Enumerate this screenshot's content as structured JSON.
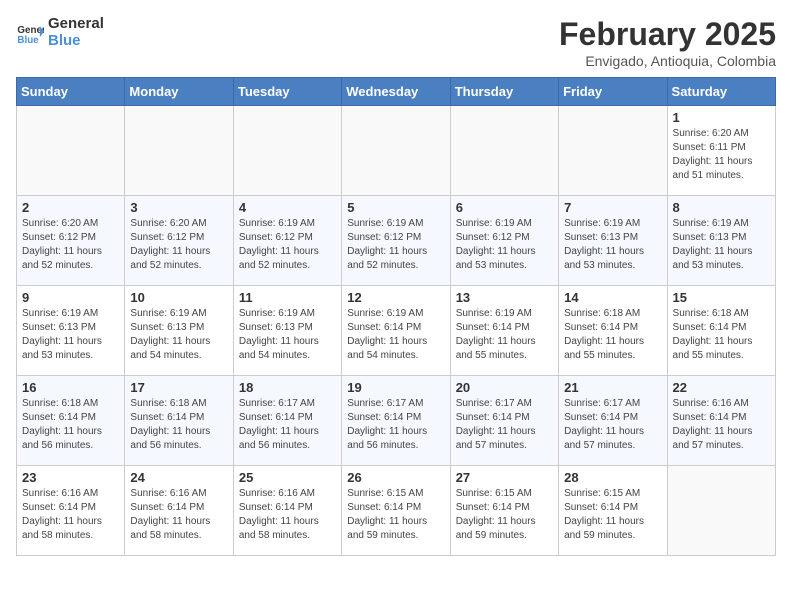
{
  "header": {
    "logo_line1": "General",
    "logo_line2": "Blue",
    "month_title": "February 2025",
    "location": "Envigado, Antioquia, Colombia"
  },
  "weekdays": [
    "Sunday",
    "Monday",
    "Tuesday",
    "Wednesday",
    "Thursday",
    "Friday",
    "Saturday"
  ],
  "weeks": [
    [
      {
        "day": "",
        "info": ""
      },
      {
        "day": "",
        "info": ""
      },
      {
        "day": "",
        "info": ""
      },
      {
        "day": "",
        "info": ""
      },
      {
        "day": "",
        "info": ""
      },
      {
        "day": "",
        "info": ""
      },
      {
        "day": "1",
        "info": "Sunrise: 6:20 AM\nSunset: 6:11 PM\nDaylight: 11 hours and 51 minutes."
      }
    ],
    [
      {
        "day": "2",
        "info": "Sunrise: 6:20 AM\nSunset: 6:12 PM\nDaylight: 11 hours and 52 minutes."
      },
      {
        "day": "3",
        "info": "Sunrise: 6:20 AM\nSunset: 6:12 PM\nDaylight: 11 hours and 52 minutes."
      },
      {
        "day": "4",
        "info": "Sunrise: 6:19 AM\nSunset: 6:12 PM\nDaylight: 11 hours and 52 minutes."
      },
      {
        "day": "5",
        "info": "Sunrise: 6:19 AM\nSunset: 6:12 PM\nDaylight: 11 hours and 52 minutes."
      },
      {
        "day": "6",
        "info": "Sunrise: 6:19 AM\nSunset: 6:12 PM\nDaylight: 11 hours and 53 minutes."
      },
      {
        "day": "7",
        "info": "Sunrise: 6:19 AM\nSunset: 6:13 PM\nDaylight: 11 hours and 53 minutes."
      },
      {
        "day": "8",
        "info": "Sunrise: 6:19 AM\nSunset: 6:13 PM\nDaylight: 11 hours and 53 minutes."
      }
    ],
    [
      {
        "day": "9",
        "info": "Sunrise: 6:19 AM\nSunset: 6:13 PM\nDaylight: 11 hours and 53 minutes."
      },
      {
        "day": "10",
        "info": "Sunrise: 6:19 AM\nSunset: 6:13 PM\nDaylight: 11 hours and 54 minutes."
      },
      {
        "day": "11",
        "info": "Sunrise: 6:19 AM\nSunset: 6:13 PM\nDaylight: 11 hours and 54 minutes."
      },
      {
        "day": "12",
        "info": "Sunrise: 6:19 AM\nSunset: 6:14 PM\nDaylight: 11 hours and 54 minutes."
      },
      {
        "day": "13",
        "info": "Sunrise: 6:19 AM\nSunset: 6:14 PM\nDaylight: 11 hours and 55 minutes."
      },
      {
        "day": "14",
        "info": "Sunrise: 6:18 AM\nSunset: 6:14 PM\nDaylight: 11 hours and 55 minutes."
      },
      {
        "day": "15",
        "info": "Sunrise: 6:18 AM\nSunset: 6:14 PM\nDaylight: 11 hours and 55 minutes."
      }
    ],
    [
      {
        "day": "16",
        "info": "Sunrise: 6:18 AM\nSunset: 6:14 PM\nDaylight: 11 hours and 56 minutes."
      },
      {
        "day": "17",
        "info": "Sunrise: 6:18 AM\nSunset: 6:14 PM\nDaylight: 11 hours and 56 minutes."
      },
      {
        "day": "18",
        "info": "Sunrise: 6:17 AM\nSunset: 6:14 PM\nDaylight: 11 hours and 56 minutes."
      },
      {
        "day": "19",
        "info": "Sunrise: 6:17 AM\nSunset: 6:14 PM\nDaylight: 11 hours and 56 minutes."
      },
      {
        "day": "20",
        "info": "Sunrise: 6:17 AM\nSunset: 6:14 PM\nDaylight: 11 hours and 57 minutes."
      },
      {
        "day": "21",
        "info": "Sunrise: 6:17 AM\nSunset: 6:14 PM\nDaylight: 11 hours and 57 minutes."
      },
      {
        "day": "22",
        "info": "Sunrise: 6:16 AM\nSunset: 6:14 PM\nDaylight: 11 hours and 57 minutes."
      }
    ],
    [
      {
        "day": "23",
        "info": "Sunrise: 6:16 AM\nSunset: 6:14 PM\nDaylight: 11 hours and 58 minutes."
      },
      {
        "day": "24",
        "info": "Sunrise: 6:16 AM\nSunset: 6:14 PM\nDaylight: 11 hours and 58 minutes."
      },
      {
        "day": "25",
        "info": "Sunrise: 6:16 AM\nSunset: 6:14 PM\nDaylight: 11 hours and 58 minutes."
      },
      {
        "day": "26",
        "info": "Sunrise: 6:15 AM\nSunset: 6:14 PM\nDaylight: 11 hours and 59 minutes."
      },
      {
        "day": "27",
        "info": "Sunrise: 6:15 AM\nSunset: 6:14 PM\nDaylight: 11 hours and 59 minutes."
      },
      {
        "day": "28",
        "info": "Sunrise: 6:15 AM\nSunset: 6:14 PM\nDaylight: 11 hours and 59 minutes."
      },
      {
        "day": "",
        "info": ""
      }
    ]
  ]
}
